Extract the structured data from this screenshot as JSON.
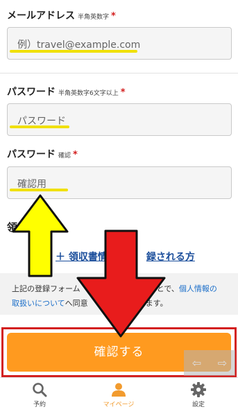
{
  "form": {
    "email": {
      "label": "メールアドレス",
      "sub": "半角英数字",
      "required_mark": "*",
      "placeholder": "例）travel@example.com"
    },
    "password": {
      "label": "パスワード",
      "sub": "半角英数字6文字以上",
      "required_mark": "*",
      "placeholder": "パスワード"
    },
    "password_confirm": {
      "label": "パスワード",
      "sub": "確認",
      "required_mark": "*",
      "placeholder": "確認用"
    },
    "receipt": {
      "title_visible": "領",
      "link_start": "＋ 領収書情",
      "link_end": "録される方"
    },
    "notice": {
      "text_1": "上記の登録フォーム",
      "text_2": "とで、",
      "link_1": "個人情報の",
      "link_2": "取扱いについて",
      "text_3": "へ同意",
      "text_4": "ります。"
    },
    "confirm_button": "確認する"
  },
  "nav_arrows": {
    "left": "⇦",
    "right": "⇨"
  },
  "tabbar": {
    "items": [
      {
        "label": "予約",
        "icon": "search-icon",
        "active": false
      },
      {
        "label": "マイページ",
        "icon": "person-icon",
        "active": true
      },
      {
        "label": "設定",
        "icon": "gear-icon",
        "active": false
      }
    ]
  },
  "colors": {
    "accent": "#ff9a1f",
    "active_tab": "#f29b2e",
    "required": "#d31d1d",
    "link": "#1c6fc9",
    "annotation_underline": "#f0e000",
    "annotation_up_arrow": "#ffff00",
    "annotation_down_arrow": "#e81c1c",
    "annotation_frame": "#d3201f"
  }
}
